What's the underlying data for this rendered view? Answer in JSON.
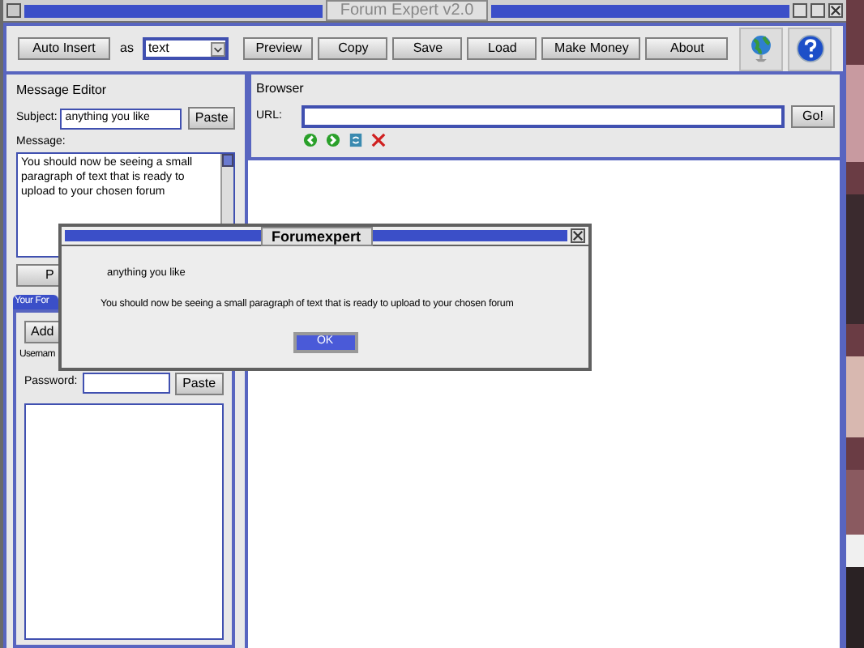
{
  "window": {
    "title": "Forum Expert v2.0"
  },
  "toolbar": {
    "auto_insert": "Auto Insert",
    "as_label": "as",
    "format": "text",
    "buttons": [
      "Preview",
      "Copy",
      "Save",
      "Load",
      "Make Money",
      "About"
    ]
  },
  "message_editor": {
    "title": "Message Editor",
    "subject_label": "Subject:",
    "subject": "anything you like",
    "paste": "Paste",
    "message_label": "Message:",
    "message": "You should now be seeing a small paragraph of text that is ready to upload to your chosen forum",
    "partial_button": "P"
  },
  "forum_panel": {
    "tab": "Your For",
    "add_button": "Add",
    "username_label": "Usernam",
    "password_label": "Password:",
    "paste": "Paste"
  },
  "browser": {
    "title": "Browser",
    "url_label": "URL:",
    "go": "Go!"
  },
  "dialog": {
    "title": "Forumexpert",
    "subject": "anything you like",
    "message": "You should now be seeing a small paragraph of text that is ready to upload to your chosen forum",
    "ok": "OK"
  }
}
